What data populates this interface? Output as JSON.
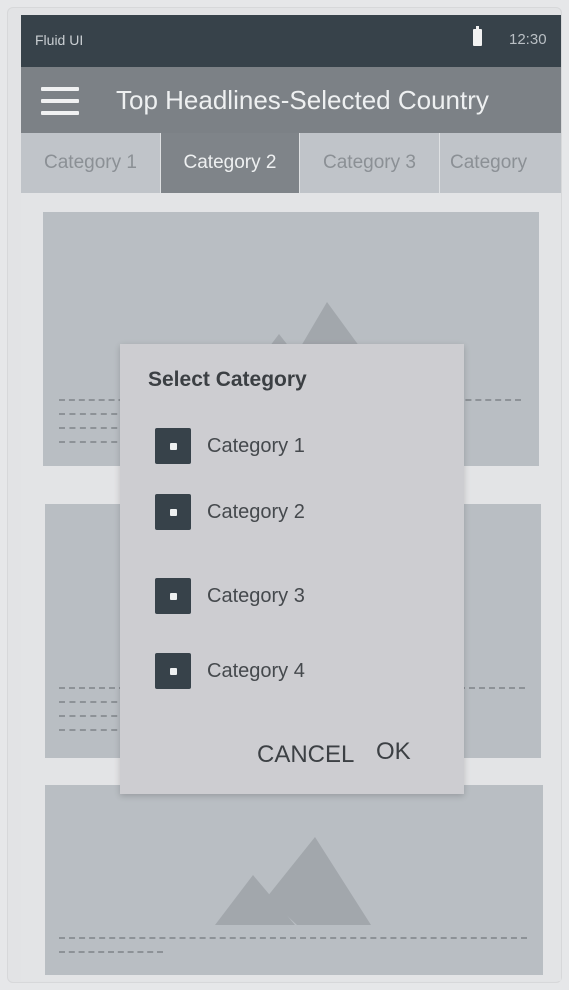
{
  "status_bar": {
    "app_name": "Fluid UI",
    "time": "12:30"
  },
  "app_bar": {
    "title": "Top Headlines-Selected Country"
  },
  "tabs": [
    {
      "label": "Category 1",
      "active": false
    },
    {
      "label": "Category 2",
      "active": true
    },
    {
      "label": "Category 3",
      "active": false
    },
    {
      "label": "Category",
      "active": false
    }
  ],
  "dialog": {
    "title": "Select Category",
    "options": [
      {
        "label": "Category 1"
      },
      {
        "label": "Category 2"
      },
      {
        "label": "Category 3"
      },
      {
        "label": "Category 4"
      }
    ],
    "cancel_label": "CANCEL",
    "ok_label": "OK"
  },
  "colors": {
    "status_bar": "#37424a",
    "app_bar": "#7c8186",
    "active_tab": "#7f8489",
    "card": "#b9bec3",
    "dialog": "#cdcdd1"
  }
}
